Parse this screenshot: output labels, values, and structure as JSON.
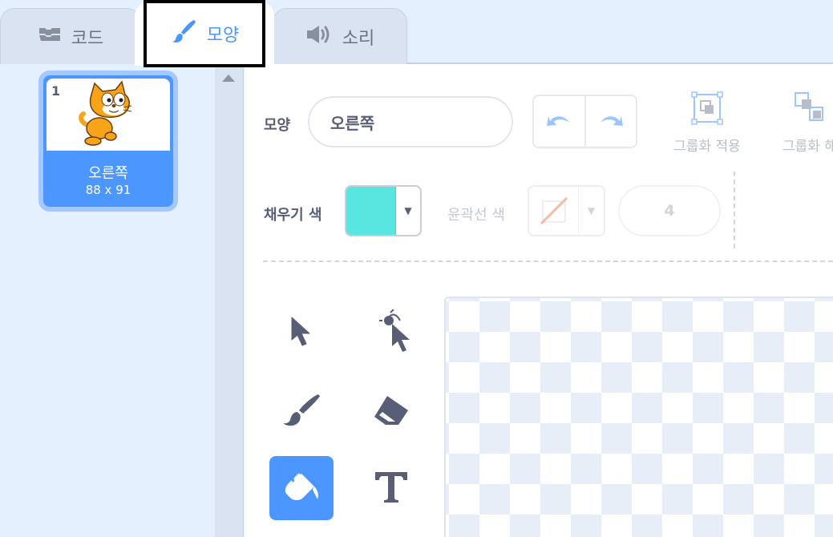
{
  "tabs": {
    "code": {
      "label": "코드",
      "icon": "code-blocks-icon"
    },
    "costumes": {
      "label": "모양",
      "icon": "paintbrush-icon"
    },
    "sounds": {
      "label": "소리",
      "icon": "speaker-icon"
    }
  },
  "costume_list": [
    {
      "number": "1",
      "name": "오른쪽",
      "size": "88 x 91"
    }
  ],
  "editor": {
    "costume_label": "모양",
    "costume_name": "오른쪽",
    "group_label": "그룹화 적용",
    "ungroup_label": "그룹화 해",
    "fill_label": "채우기 색",
    "fill_color": "#59e5e0",
    "outline_label": "윤곽선 색",
    "outline_width": "4"
  },
  "tools": [
    "select-tool",
    "reshape-tool",
    "brush-tool",
    "eraser-tool",
    "fill-tool",
    "text-tool"
  ],
  "colors": {
    "accent": "#4c97ff",
    "tab_bg": "#e5f0ff"
  }
}
